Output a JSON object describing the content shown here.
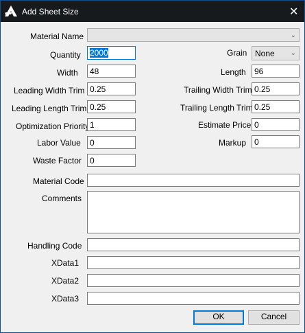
{
  "window": {
    "title": "Add Sheet Size",
    "close_glyph": "✕"
  },
  "labels": {
    "material_name": "Material Name",
    "quantity": "Quantity",
    "grain": "Grain",
    "width": "Width",
    "length": "Length",
    "leading_width_trim": "Leading Width Trim",
    "trailing_width_trim": "Trailing Width Trim",
    "leading_length_trim": "Leading Length Trim",
    "trailing_length_trim": "Trailing Length Trim",
    "optimization_priority": "Optimization Priority",
    "estimate_price": "Estimate Price",
    "labor_value": "Labor Value",
    "markup": "Markup",
    "waste_factor": "Waste Factor",
    "material_code": "Material Code",
    "comments": "Comments",
    "handling_code": "Handling Code",
    "xdata1": "XData1",
    "xdata2": "XData2",
    "xdata3": "XData3"
  },
  "values": {
    "material_name": "",
    "quantity": "2000",
    "grain": "None",
    "width": "48",
    "length": "96",
    "leading_width_trim": "0.25",
    "trailing_width_trim": "0.25",
    "leading_length_trim": "0.25",
    "trailing_length_trim": "0.25",
    "optimization_priority": "1",
    "estimate_price": "0",
    "labor_value": "0",
    "markup": "0",
    "waste_factor": "0",
    "material_code": "",
    "comments": "",
    "handling_code": "",
    "xdata1": "",
    "xdata2": "",
    "xdata3": ""
  },
  "buttons": {
    "ok": "OK",
    "cancel": "Cancel"
  },
  "icons": {
    "app": "app-logo-icon",
    "close": "close-icon",
    "dropdown": "chevron-down-icon"
  }
}
